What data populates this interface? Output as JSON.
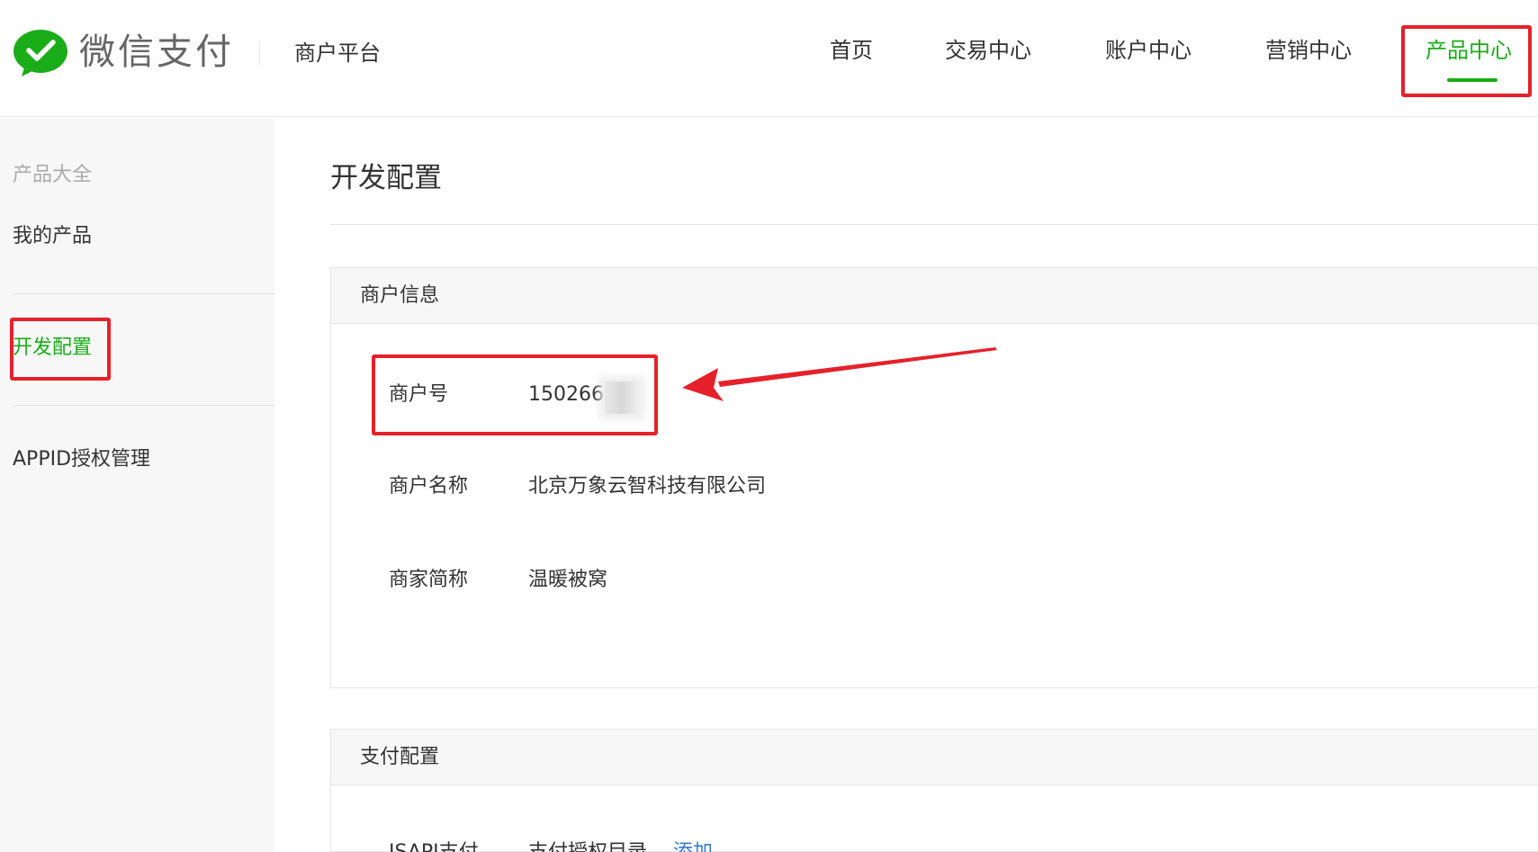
{
  "header": {
    "brand": "微信支付",
    "platform": "商户平台",
    "nav": [
      {
        "label": "首页",
        "active": false
      },
      {
        "label": "交易中心",
        "active": false
      },
      {
        "label": "账户中心",
        "active": false
      },
      {
        "label": "营销中心",
        "active": false
      },
      {
        "label": "产品中心",
        "active": true
      }
    ]
  },
  "sidebar": {
    "items": [
      {
        "label": "产品大全",
        "state": "muted"
      },
      {
        "label": "我的产品",
        "state": "normal"
      },
      {
        "label": "开发配置",
        "state": "active"
      },
      {
        "label": "APPID授权管理",
        "state": "normal"
      }
    ]
  },
  "main": {
    "title": "开发配置",
    "merchant_info": {
      "heading": "商户信息",
      "fields": [
        {
          "label": "商户号",
          "value": "1502666"
        },
        {
          "label": "商户名称",
          "value": "北京万象云智科技有限公司"
        },
        {
          "label": "商家简称",
          "value": "温暖被窝"
        }
      ]
    },
    "payment_config": {
      "heading": "支付配置",
      "row_label": "JSAPI支付",
      "row_value": "支付授权目录",
      "row_link": "添加"
    }
  },
  "colors": {
    "accent": "#1aad19",
    "highlight": "#e5212b",
    "link": "#3a7bd5"
  },
  "icons": {
    "logo": "wechat-pay-logo-icon",
    "arrow": "annotation-arrow-icon"
  }
}
